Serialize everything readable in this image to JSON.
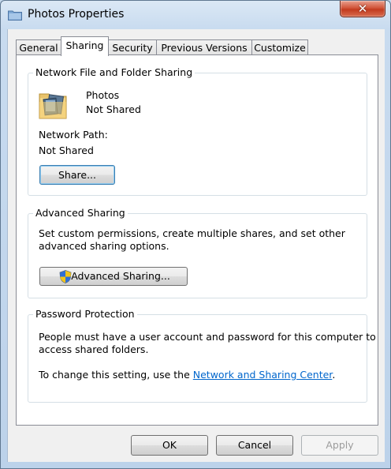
{
  "window": {
    "title": "Photos Properties",
    "close_label": "✕"
  },
  "tabs": [
    {
      "label": "General"
    },
    {
      "label": "Sharing"
    },
    {
      "label": "Security"
    },
    {
      "label": "Previous Versions"
    },
    {
      "label": "Customize"
    }
  ],
  "network_sharing": {
    "heading": "Network File and Folder Sharing",
    "folder_name": "Photos",
    "folder_status": "Not Shared",
    "path_label": "Network Path:",
    "path_value": "Not Shared",
    "share_button": "Share..."
  },
  "advanced_sharing": {
    "heading": "Advanced Sharing",
    "description_line1": "Set custom permissions, create multiple shares, and set other",
    "description_line2": "advanced sharing options.",
    "button_label": "Advanced Sharing..."
  },
  "password_protection": {
    "heading": "Password Protection",
    "line1": "People must have a user account and password for this computer to",
    "line2": "access shared folders.",
    "change_prefix": "To change this setting, use the ",
    "link_text": "Network and Sharing Center",
    "change_suffix": "."
  },
  "footer": {
    "ok": "OK",
    "cancel": "Cancel",
    "apply": "Apply"
  }
}
